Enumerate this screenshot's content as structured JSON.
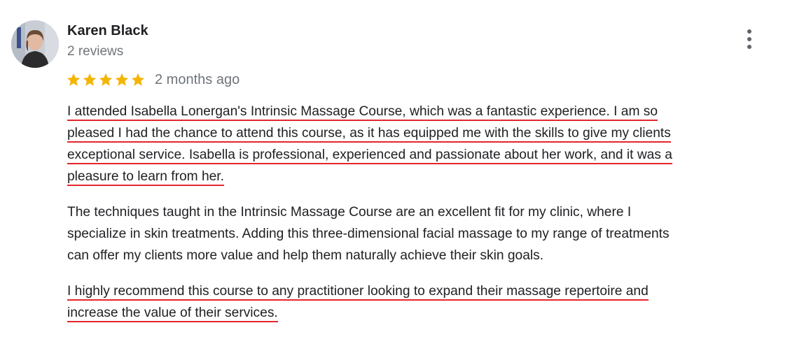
{
  "reviewer": {
    "name": "Karen Black",
    "review_count": "2 reviews"
  },
  "rating": {
    "stars": 5,
    "max_stars": 5,
    "star_color": "#f4b400",
    "date": "2 months ago"
  },
  "more_icon": "more-vertical-icon",
  "highlight_color": "#e3262d",
  "review": {
    "paragraph1": [
      "I attended Isabella Lonergan's Intrinsic Massage Course, which was a fantastic experience. I am so",
      "pleased I had the chance to attend this course, as it has equipped me with the skills to give my clients",
      "exceptional service. Isabella is professional, experienced and passionate about her work, and it was a",
      "pleasure to learn from her."
    ],
    "paragraph2": [
      "The techniques taught in the Intrinsic Massage Course are an excellent fit for my clinic, where I",
      "specialize in skin treatments. Adding this three-dimensional facial massage to my range of treatments",
      "can offer my clients more value and help them naturally achieve their skin goals."
    ],
    "paragraph3": [
      "I highly recommend this course to any practitioner looking to expand their massage repertoire and",
      "increase the value of their services."
    ]
  }
}
